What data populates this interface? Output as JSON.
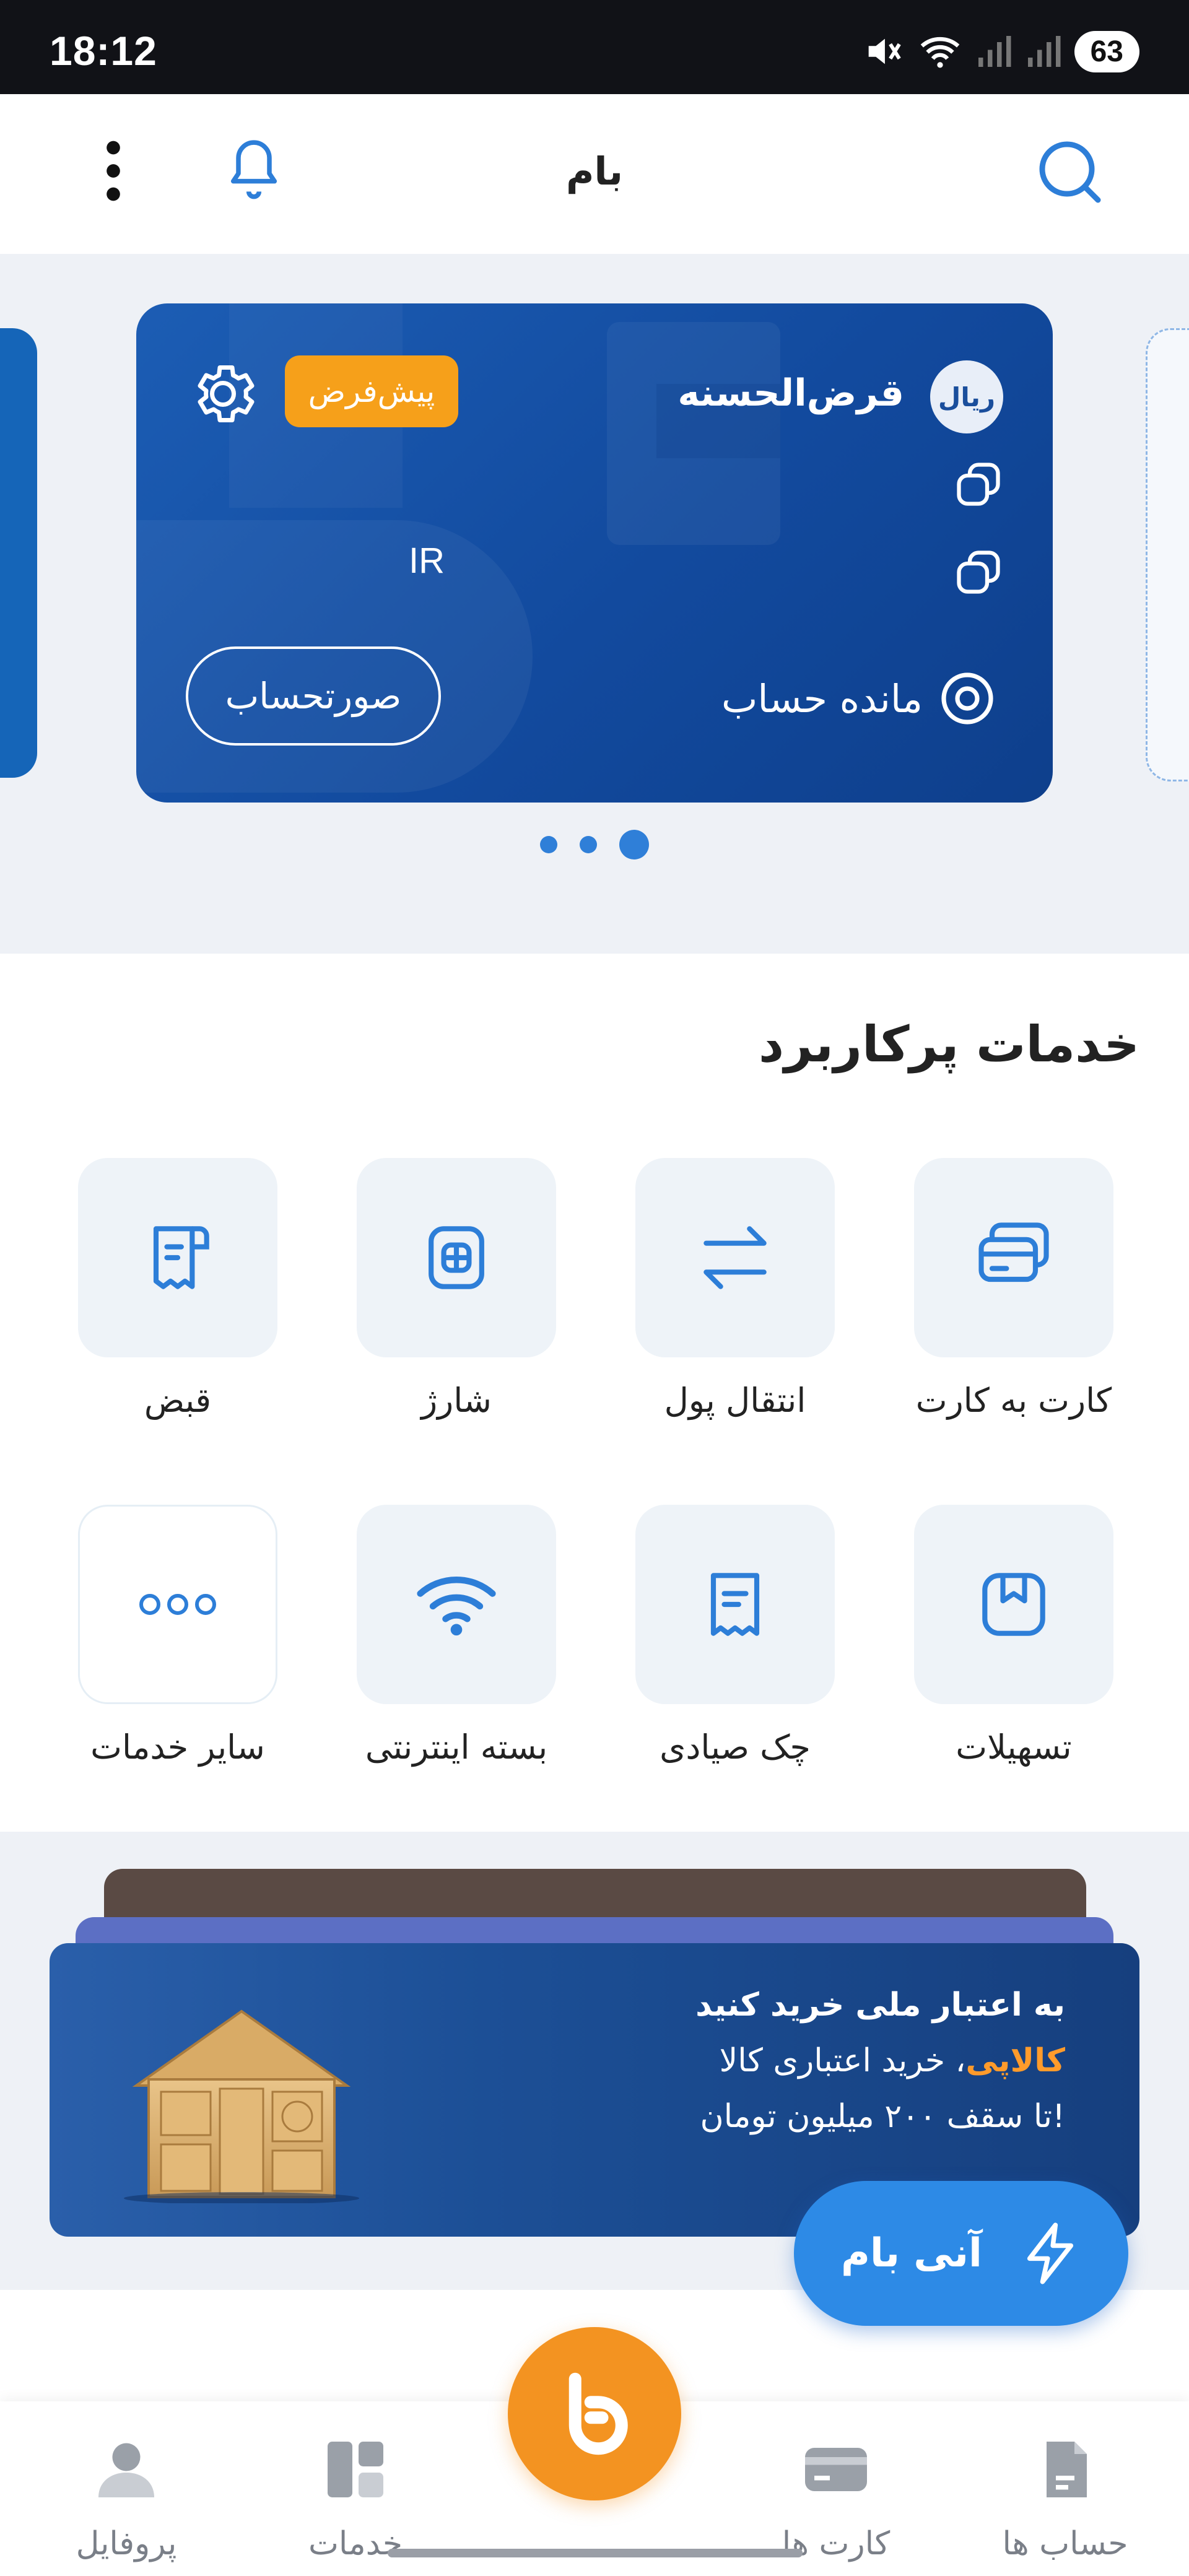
{
  "status_bar": {
    "time": "18:12",
    "battery": "63"
  },
  "header": {
    "title": "بام"
  },
  "account_card": {
    "currency": "ریال",
    "account_type": "قرض‌الحسنه",
    "default_badge": "پیش‌فرض",
    "iban_prefix": "IR",
    "balance_label": "مانده حساب",
    "statement_button": "صورتحساب"
  },
  "carousel": {
    "dot_count": 3,
    "active_dot": 3
  },
  "services": {
    "title": "خدمات پرکاربرد",
    "items": [
      {
        "label": "کارت به کارت",
        "icon": "cards-icon"
      },
      {
        "label": "انتقال پول",
        "icon": "transfer-icon"
      },
      {
        "label": "شارژ",
        "icon": "sim-card-icon"
      },
      {
        "label": "قبض",
        "icon": "bill-icon"
      },
      {
        "label": "تسهیلات",
        "icon": "bookmark-icon"
      },
      {
        "label": "چک صیادی",
        "icon": "cheque-icon"
      },
      {
        "label": "بسته اینترنتی",
        "icon": "wifi-icon"
      },
      {
        "label": "سایر خدمات",
        "icon": "more-dots-icon"
      }
    ]
  },
  "promo": {
    "line1": "به اعتبار ملی خرید کنید",
    "brand": "کالاپی",
    "line2_rest": "، خرید اعتباری کالا",
    "line3": "تا سقف ۲۰۰ میلیون تومان!"
  },
  "ani_bam": {
    "label": "آنی بام"
  },
  "bottom_nav": {
    "items": [
      {
        "label": "حساب ها",
        "icon": "accounts-icon"
      },
      {
        "label": "کارت ها",
        "icon": "card-icon"
      },
      {
        "label": "خدمات",
        "icon": "services-icon"
      },
      {
        "label": "پروفایل",
        "icon": "profile-icon"
      }
    ]
  },
  "colors": {
    "primary_blue": "#2d7ed8",
    "card_blue": "#124a9e",
    "accent_orange": "#f39321",
    "badge_orange": "#f6a01a"
  }
}
